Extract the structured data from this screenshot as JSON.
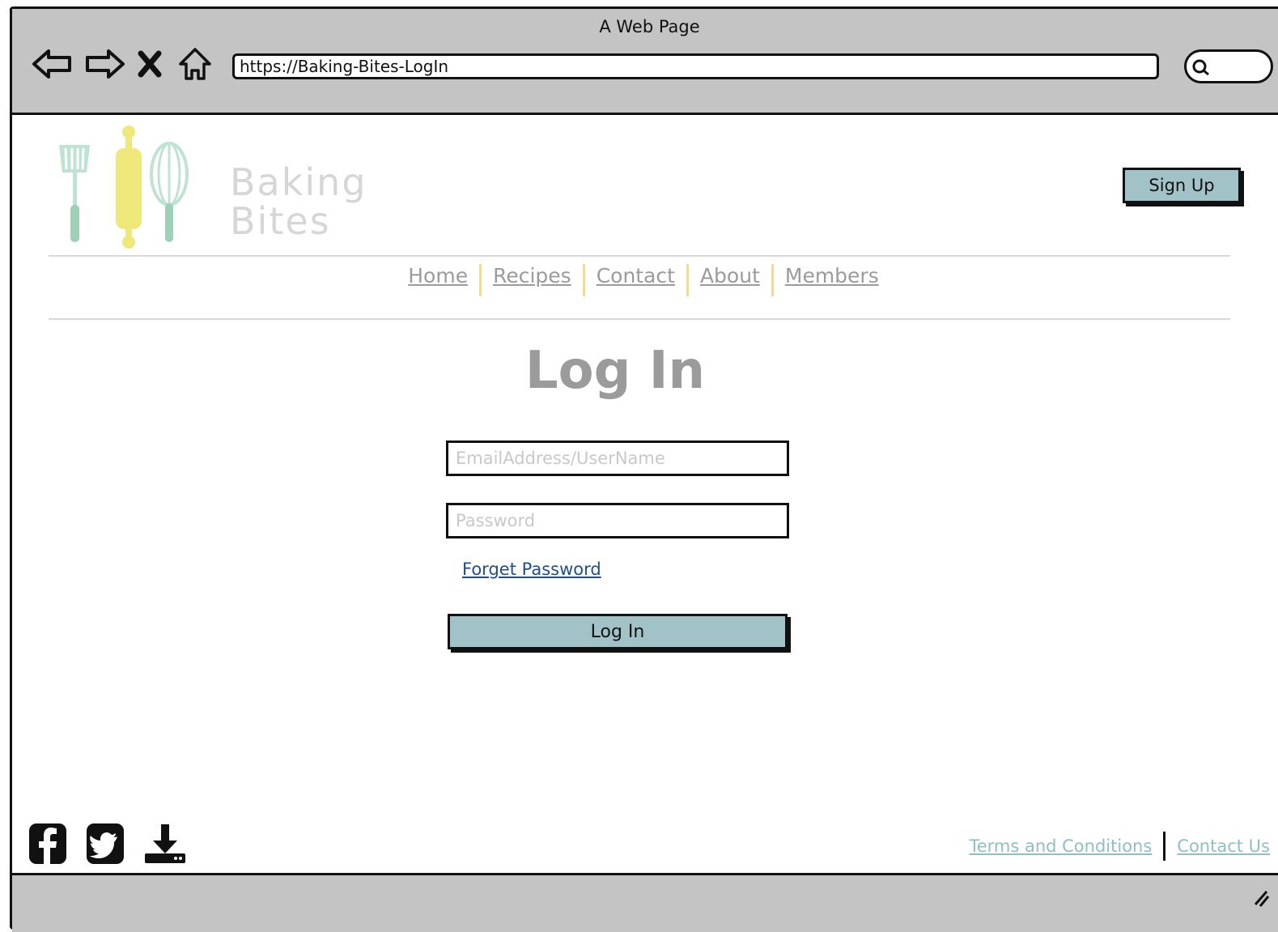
{
  "browser": {
    "window_title": "A Web Page",
    "url": "https://Baking-Bites-LogIn"
  },
  "header": {
    "logo_text_line1": "Baking",
    "logo_text_line2": "Bites",
    "signup_label": "Sign Up"
  },
  "nav": {
    "items": [
      "Home",
      "Recipes",
      "Contact",
      "About",
      "Members"
    ]
  },
  "login": {
    "title": "Log In",
    "email_placeholder": "EmailAddress/UserName",
    "password_placeholder": "Password",
    "forgot_label": "Forget Password",
    "submit_label": "Log In"
  },
  "footer": {
    "social_icons": [
      "facebook-icon",
      "twitter-icon",
      "download-icon"
    ],
    "terms_label": "Terms and Conditions",
    "contact_label": "Contact Us"
  },
  "colors": {
    "button_fill": "#a1c3c8",
    "nav_link": "#9b9b9b",
    "nav_separator": "#f6d98a",
    "forgot_link": "#1d4f8f",
    "footer_link": "#8fbfc4",
    "chrome": "#c4c4c4"
  }
}
